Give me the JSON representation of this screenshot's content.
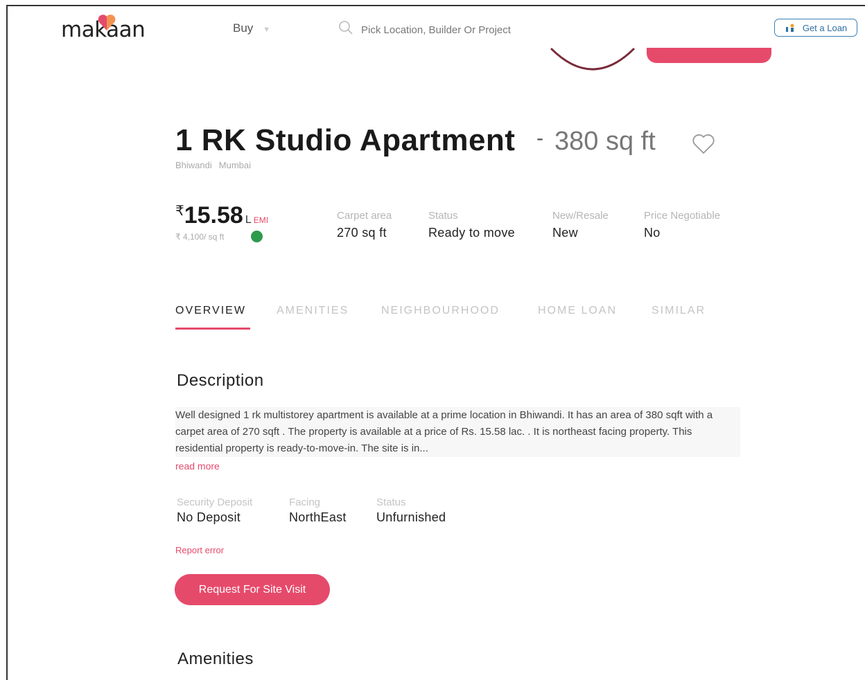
{
  "header": {
    "logo_text": "makaan",
    "nav_buy": "Buy",
    "search_placeholder": "Pick Location, Builder Or Project",
    "loan_label": "Get a Loan"
  },
  "listing": {
    "title": "1 RK Studio Apartment",
    "separator": "-",
    "area": "380 sq ft",
    "locality": "Bhiwandi",
    "city": "Mumbai",
    "price_symbol": "₹",
    "price": "15.58",
    "price_unit": "L",
    "emi_label": "EMI",
    "per_sqft": "₹ 4,100/ sq ft",
    "stats": [
      {
        "label": "Carpet area",
        "value": "270 sq ft"
      },
      {
        "label": "Status",
        "value": "Ready to move"
      },
      {
        "label": "New/Resale",
        "value": "New"
      },
      {
        "label": "Price Negotiable",
        "value": "No"
      }
    ]
  },
  "tabs": [
    "OVERVIEW",
    "AMENITIES",
    "NEIGHBOURHOOD",
    "HOME LOAN",
    "SIMILAR"
  ],
  "active_tab": "OVERVIEW",
  "description": {
    "heading": "Description",
    "text": "Well designed 1 rk multistorey apartment is available at a prime location in Bhiwandi. It has an area of 380 sqft with a carpet area of 270 sqft . The property is available at a price of Rs. 15.58 lac. . It is northeast facing property. This residential property is ready-to-move-in. The site is in...",
    "read_more": "read more"
  },
  "details": [
    {
      "label": "Security Deposit",
      "value": "No Deposit"
    },
    {
      "label": "Facing",
      "value": "NorthEast"
    },
    {
      "label": "Status",
      "value": "Unfurnished"
    }
  ],
  "report_error": "Report error",
  "site_visit_button": "Request For Site Visit",
  "amenities_heading": "Amenities",
  "colors": {
    "accent": "#e64a6b",
    "loan_blue": "#2f6fa3",
    "info_green": "#2d9a4c"
  },
  "icons": [
    "heart-logo-icon",
    "search-icon",
    "loan-icon",
    "favorite-heart-icon",
    "info-icon"
  ]
}
